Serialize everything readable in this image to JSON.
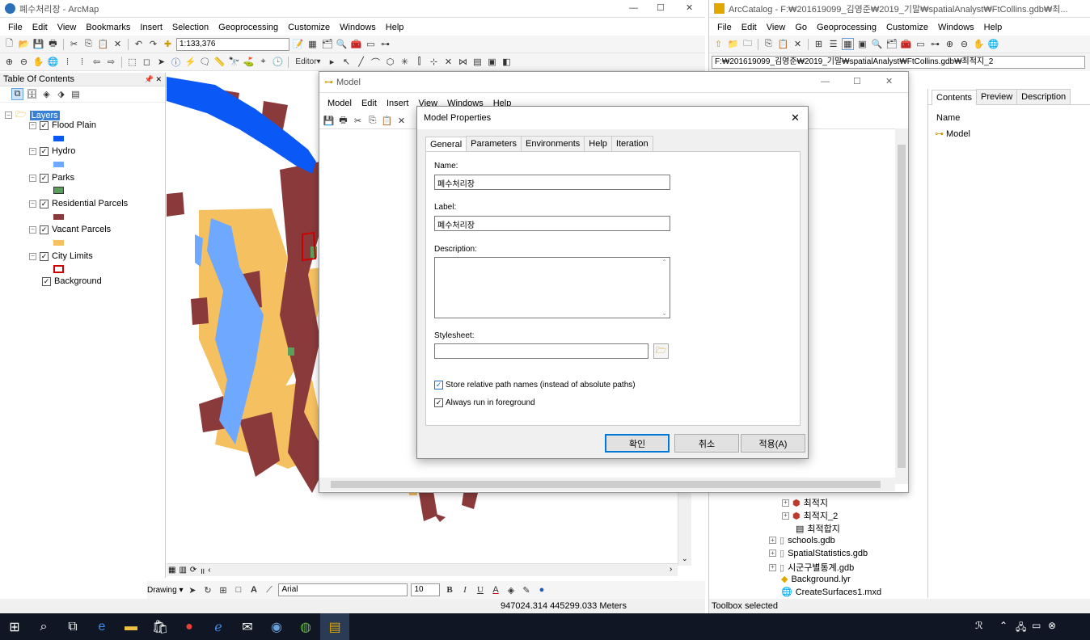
{
  "arcmap": {
    "title": "폐수처리장 - ArcMap",
    "menus": [
      "File",
      "Edit",
      "View",
      "Bookmarks",
      "Insert",
      "Selection",
      "Geoprocessing",
      "Customize",
      "Windows",
      "Help"
    ],
    "scale": "1:133,376",
    "editor_label": "Editor▾",
    "toc_title": "Table Of Contents",
    "toc_pin": "📌 ✕",
    "layers_root": "Layers",
    "layers": [
      {
        "name": "Flood Plain",
        "color": "#0a58f5"
      },
      {
        "name": "Hydro",
        "color": "#6fa8ff"
      },
      {
        "name": "Parks",
        "color": "#5aa05a"
      },
      {
        "name": "Residential Parcels",
        "color": "#8a3a3a"
      },
      {
        "name": "Vacant Parcels",
        "color": "#f5c060"
      },
      {
        "name": "City Limits",
        "color": "#cc0000"
      },
      {
        "name": "Background",
        "color": ""
      }
    ],
    "drawing_label": "Drawing ▾",
    "font_name": "Arial",
    "font_size": "10",
    "coords": "947024.314  445299.033 Meters"
  },
  "model": {
    "title": "Model",
    "menus": [
      "Model",
      "Edit",
      "Insert",
      "View",
      "Windows",
      "Help"
    ]
  },
  "dialog": {
    "title": "Model Properties",
    "close": "✕",
    "tabs": [
      "General",
      "Parameters",
      "Environments",
      "Help",
      "Iteration"
    ],
    "name_label": "Name:",
    "name_value": "폐수처리장",
    "label_label": "Label:",
    "label_value": "폐수처리장",
    "description_label": "Description:",
    "stylesheet_label": "Stylesheet:",
    "check1": "Store relative path names (instead of absolute paths)",
    "check2": "Always run in foreground",
    "ok": "확인",
    "cancel": "취소",
    "apply": "적용(A)"
  },
  "arccatalog": {
    "title": "ArcCatalog - F:₩201619099_김영준₩2019_기말₩spatialAnalyst₩FtCollins.gdb₩최...",
    "menus": [
      "File",
      "Edit",
      "View",
      "Go",
      "Geoprocessing",
      "Customize",
      "Windows",
      "Help"
    ],
    "path": "F:₩201619099_김영준₩2019_기말₩spatialAnalyst₩FtCollins.gdb₩최적지_2",
    "tabs": [
      "Contents",
      "Preview",
      "Description"
    ],
    "col_name": "Name",
    "item_model": "Model",
    "tree": [
      "최적지",
      "최적지_2",
      "최적합지",
      "schools.gdb",
      "SpatialStatistics.gdb",
      "시군구별통계.gdb",
      "Background.lyr",
      "CreateSurfaces1.mxd"
    ],
    "status": "Toolbox selected"
  }
}
